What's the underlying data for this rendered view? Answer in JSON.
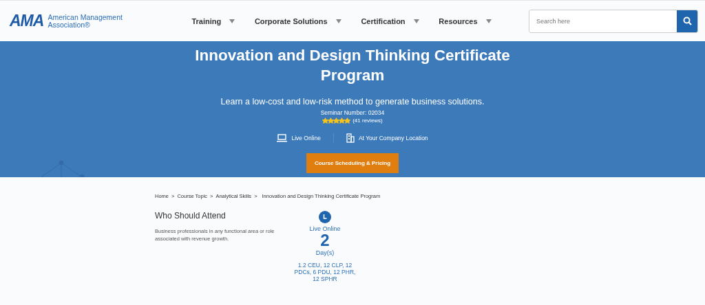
{
  "header": {
    "logo": {
      "mark": "AMA",
      "name_line1": "American Management",
      "name_line2": "Association®"
    },
    "nav": [
      {
        "label": "Training",
        "has_menu": true
      },
      {
        "label": "Corporate Solutions",
        "has_menu": true
      },
      {
        "label": "Certification",
        "has_menu": true
      },
      {
        "label": "Resources",
        "has_menu": true
      }
    ],
    "search": {
      "placeholder": "Search here"
    }
  },
  "hero": {
    "title": "Innovation and Design Thinking Certificate Program",
    "subtitle": "Learn a low-cost and low-risk method to generate business solutions.",
    "seminar_number": "Seminar Number: 02034",
    "stars": 5,
    "reviews": "(41 reviews)",
    "formats": [
      {
        "kind": "laptop",
        "label": "Live Online"
      },
      {
        "kind": "building",
        "label": "At Your Company Location"
      }
    ],
    "button": "Course Scheduling & Pricing"
  },
  "breadcrumb": [
    {
      "kind": "link",
      "label": "Home"
    },
    {
      "kind": "separator",
      "label": ">"
    },
    {
      "kind": "link",
      "label": "Course Topic"
    },
    {
      "kind": "separator",
      "label": ">"
    },
    {
      "kind": "link",
      "label": "Analytical Skills"
    },
    {
      "kind": "separator",
      "label": ">"
    },
    {
      "kind": "current",
      "label": "Innovation and Design Thinking Certificate Program"
    }
  ],
  "who_should_attend": {
    "heading": "Who Should Attend",
    "text": "Business professionals in any functional area or role associated with revenue growth."
  },
  "course_info": {
    "format": "Live Online",
    "duration": "2",
    "duration_unit": "Day(s)",
    "credits": "1.2 CEU, 12 CLP, 12 PDCs, 6 PDU, 12 PHR, 12 SPHR"
  }
}
